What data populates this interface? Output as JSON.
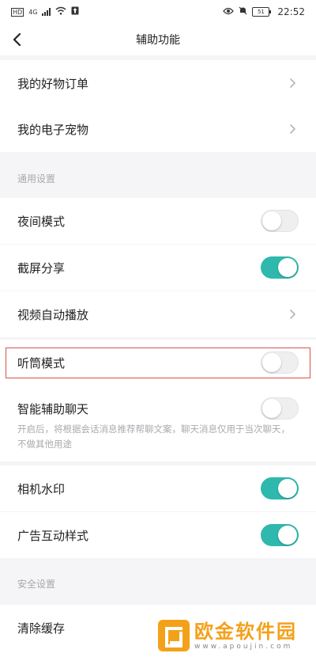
{
  "status_bar": {
    "hd_label": "HD",
    "network": "4G",
    "time": "22:52",
    "battery": "51"
  },
  "navbar": {
    "title": "辅助功能"
  },
  "top_items": [
    {
      "label": "我的好物订单"
    },
    {
      "label": "我的电子宠物"
    }
  ],
  "sections": {
    "general": "通用设置",
    "security": "安全设置"
  },
  "settings": {
    "night_mode": {
      "label": "夜间模式",
      "on": false
    },
    "screenshot_share": {
      "label": "截屏分享",
      "on": true
    },
    "video_autoplay": {
      "label": "视频自动播放"
    },
    "earpiece_mode": {
      "label": "听筒模式",
      "on": false
    },
    "smart_chat": {
      "label": "智能辅助聊天",
      "on": false,
      "description": "开启后，将根据会话消息推荐帮聊文案，聊天消息仅用于当次聊天，不做其他用途"
    },
    "camera_watermark": {
      "label": "相机水印",
      "on": true
    },
    "ad_interaction": {
      "label": "广告互动样式",
      "on": true
    },
    "clear_cache": {
      "label": "清除缓存"
    }
  },
  "watermark": {
    "brand": "欧金软件园",
    "url": "www.apoujin.com"
  },
  "colors": {
    "accent": "#2fb8ad",
    "highlight_border": "#d9534f",
    "watermark": "#f4a11a"
  }
}
